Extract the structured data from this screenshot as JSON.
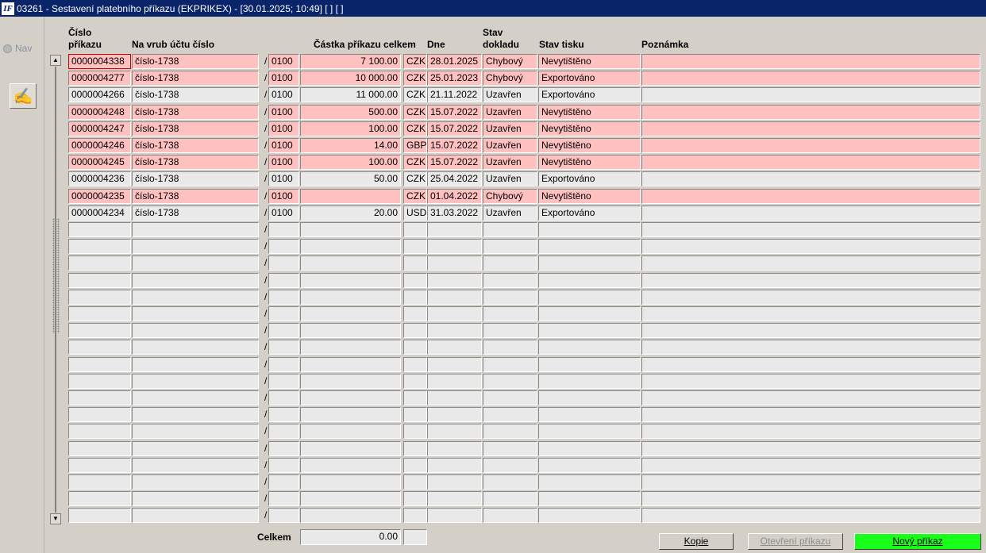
{
  "window": {
    "title": "03261 - Sestavení platebního příkazu (EKPRIKEX) - [30.01.2025; 10:49]  [ ]  [ ]",
    "icon_text": "IF"
  },
  "nav": {
    "label": "Nav"
  },
  "headers": {
    "cislo_line1": "Číslo",
    "cislo_line2": "příkazu",
    "ucet": "Na vrub účtu číslo",
    "castka": "Částka příkazu celkem",
    "dne": "Dne",
    "stav_line1": "Stav",
    "stav_line2": "dokladu",
    "tisk": "Stav tisku",
    "poznamka": "Poznámka"
  },
  "rows": [
    {
      "cislo": "0000004338",
      "ucet": "číslo-1738",
      "kod": "0100",
      "castka": "7 100.00",
      "mena": "CZK",
      "dne": "28.01.2025",
      "stav": "Chybový",
      "tisk": "Nevytištěno",
      "poznamka": "",
      "error": true
    },
    {
      "cislo": "0000004277",
      "ucet": "číslo-1738",
      "kod": "0100",
      "castka": "10 000.00",
      "mena": "CZK",
      "dne": "25.01.2023",
      "stav": "Chybový",
      "tisk": "Exportováno",
      "poznamka": "",
      "error": true
    },
    {
      "cislo": "0000004266",
      "ucet": "číslo-1738",
      "kod": "0100",
      "castka": "11 000.00",
      "mena": "CZK",
      "dne": "21.11.2022",
      "stav": "Uzavřen",
      "tisk": "Exportováno",
      "poznamka": "",
      "error": false
    },
    {
      "cislo": "0000004248",
      "ucet": "číslo-1738",
      "kod": "0100",
      "castka": "500.00",
      "mena": "CZK",
      "dne": "15.07.2022",
      "stav": "Uzavřen",
      "tisk": "Nevytištěno",
      "poznamka": "",
      "error": true
    },
    {
      "cislo": "0000004247",
      "ucet": "číslo-1738",
      "kod": "0100",
      "castka": "100.00",
      "mena": "CZK",
      "dne": "15.07.2022",
      "stav": "Uzavřen",
      "tisk": "Nevytištěno",
      "poznamka": "",
      "error": true
    },
    {
      "cislo": "0000004246",
      "ucet": "číslo-1738",
      "kod": "0100",
      "castka": "14.00",
      "mena": "GBP",
      "dne": "15.07.2022",
      "stav": "Uzavřen",
      "tisk": "Nevytištěno",
      "poznamka": "",
      "error": true
    },
    {
      "cislo": "0000004245",
      "ucet": "číslo-1738",
      "kod": "0100",
      "castka": "100.00",
      "mena": "CZK",
      "dne": "15.07.2022",
      "stav": "Uzavřen",
      "tisk": "Nevytištěno",
      "poznamka": "",
      "error": true
    },
    {
      "cislo": "0000004236",
      "ucet": "číslo-1738",
      "kod": "0100",
      "castka": "50.00",
      "mena": "CZK",
      "dne": "25.04.2022",
      "stav": "Uzavřen",
      "tisk": "Exportováno",
      "poznamka": "",
      "error": false
    },
    {
      "cislo": "0000004235",
      "ucet": "číslo-1738",
      "kod": "0100",
      "castka": "",
      "mena": "CZK",
      "dne": "01.04.2022",
      "stav": "Chybový",
      "tisk": "Nevytištěno",
      "poznamka": "",
      "error": true
    },
    {
      "cislo": "0000004234",
      "ucet": "číslo-1738",
      "kod": "0100",
      "castka": "20.00",
      "mena": "USD",
      "dne": "31.03.2022",
      "stav": "Uzavřen",
      "tisk": "Exportováno",
      "poznamka": "",
      "error": false
    }
  ],
  "empty_row_count": 18,
  "slash_char": "/",
  "footer": {
    "celkem_label": "Celkem",
    "celkem_value": "0.00",
    "celkem_mena": ""
  },
  "buttons": {
    "kopie": "Kopie",
    "otevreni": "Otevření příkazu",
    "novy": "Nový příkaz"
  },
  "colors": {
    "error_row": "#ffc0c0",
    "new_button": "#19ff19",
    "titlebar": "#0a246a"
  }
}
